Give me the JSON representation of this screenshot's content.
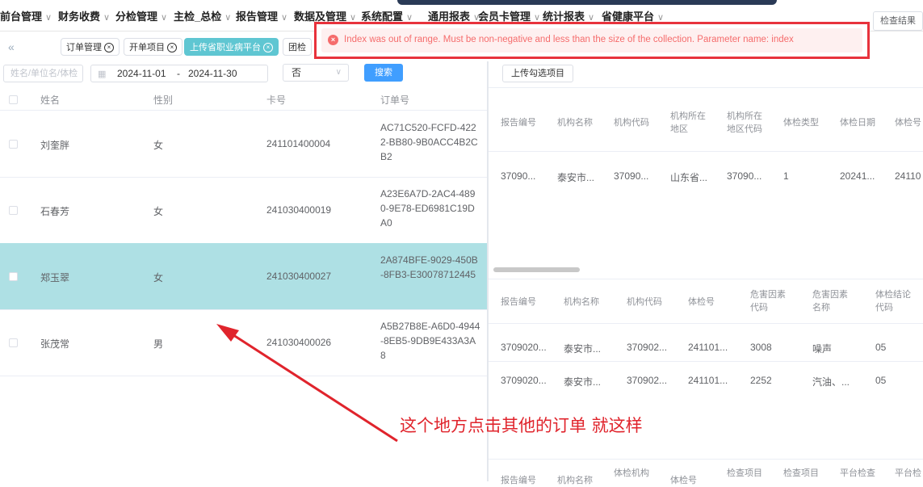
{
  "menu": {
    "items": [
      "前台管理",
      "财务收费",
      "分检管理",
      "主检_总检",
      "报告管理",
      "数据及管理",
      "系统配置",
      "通用报表",
      "会员卡管理",
      "统计报表",
      "省健康平台"
    ],
    "check_result_button": "检查结果"
  },
  "tabs": {
    "collapse_icon": "double-chevron-left-icon",
    "items": [
      {
        "label": "订单管理",
        "active": false
      },
      {
        "label": "开单项目",
        "active": false
      },
      {
        "label": "上传省职业病平台",
        "active": true
      },
      {
        "label": "团检",
        "active": false
      }
    ]
  },
  "error": {
    "icon": "error-circle-icon",
    "message": "Index was out of range. Must be non-negative and less than the size of the collection. Parameter name: index"
  },
  "filters": {
    "name_placeholder": "姓名/单位名/体检",
    "date_start": "2024-11-01",
    "date_sep": "-",
    "date_end": "2024-11-30",
    "select_value": "否",
    "search_button": "搜索"
  },
  "left_table": {
    "columns": [
      "姓名",
      "性别",
      "卡号",
      "订单号"
    ],
    "rows": [
      {
        "name": "刘奎胖",
        "gender": "女",
        "card": "241101400004",
        "order": "AC71C520-FCFD-4222-BB80-9B0ACC4B2CB2",
        "selected": false
      },
      {
        "name": "石春芳",
        "gender": "女",
        "card": "241030400019",
        "order": "A23E6A7D-2AC4-4890-9E78-ED6981C19DA0",
        "selected": false
      },
      {
        "name": "郑玉翠",
        "gender": "女",
        "card": "241030400027",
        "order": "2A874BFE-9029-450B-8FB3-E30078712445",
        "selected": true
      },
      {
        "name": "张茂常",
        "gender": "男",
        "card": "241030400026",
        "order": "A5B27B8E-A6D0-4944-8EB5-9DB9E433A3A8",
        "selected": false
      }
    ]
  },
  "right_panel": {
    "upload_button": "上传勾选项目",
    "table1": {
      "headers": [
        "报告编号",
        "机构名称",
        "机构代码",
        "机构所在地区",
        "机构所在地区代码",
        "体检类型",
        "体检日期",
        "体检号"
      ],
      "row": [
        "37090...",
        "泰安市...",
        "37090...",
        "山东省...",
        "37090...",
        "1",
        "20241...",
        "24110"
      ]
    },
    "table2": {
      "headers": [
        "报告编号",
        "机构名称",
        "机构代码",
        "体检号",
        "危害因素代码",
        "危害因素名称",
        "体检结论代码"
      ],
      "rows": [
        [
          "3709020...",
          "泰安市...",
          "370902...",
          "241101...",
          "3008",
          "噪声",
          "05"
        ],
        [
          "3709020...",
          "泰安市...",
          "370902...",
          "241101...",
          "2252",
          "汽油、...",
          "05"
        ]
      ]
    },
    "table3": {
      "headers": [
        "报告编号",
        "机构名称",
        "体检机构",
        "体检号",
        "检查项目",
        "检查项目",
        "平台检查",
        "平台检"
      ]
    }
  },
  "annotation": {
    "text": "这个地方点击其他的订单 就这样",
    "color": "#e0242c"
  },
  "colors": {
    "accent": "#409eff",
    "selected_row": "#aee0e4",
    "active_tab": "#5fc6d2",
    "error": "#f56c6c"
  }
}
